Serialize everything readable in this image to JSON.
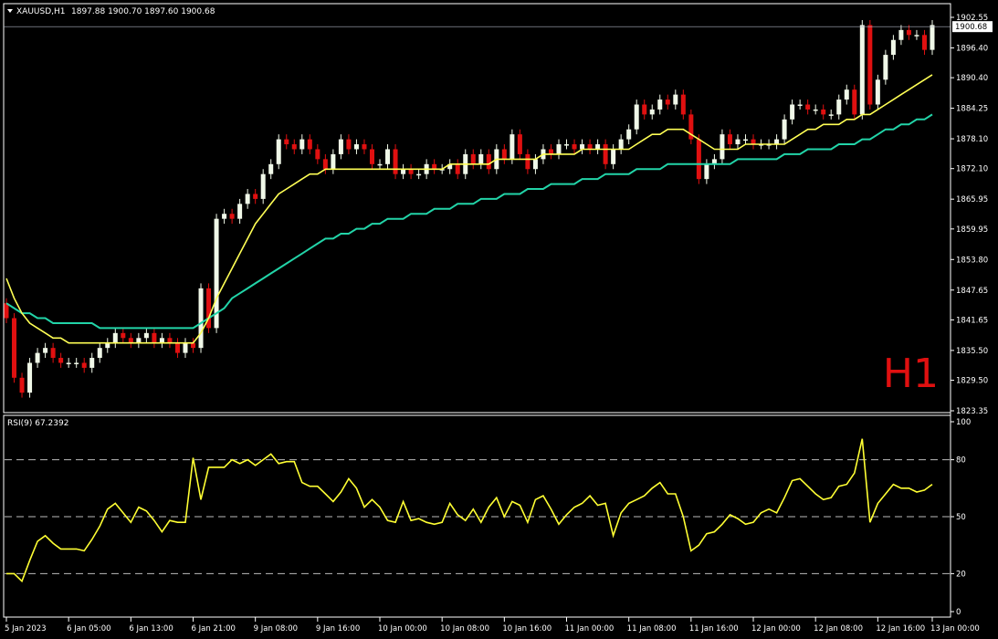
{
  "header": {
    "title": "XAUUSD,H1",
    "ohlc": "1897.88 1900.70 1897.60 1900.68"
  },
  "timeframe_badge": "H1",
  "colors": {
    "background": "#000000",
    "bull": "#f0f8e8",
    "bear": "#e01010",
    "ma_fast": "#ffff55",
    "ma_slow": "#22d4a8",
    "rsi": "#ffff33",
    "axis": "#ffffff",
    "badge": "#e01010"
  },
  "price_axis": {
    "ticks": [
      "1902.55",
      "1896.40",
      "1890.40",
      "1884.25",
      "1878.10",
      "1872.10",
      "1865.95",
      "1859.95",
      "1853.80",
      "1847.65",
      "1841.65",
      "1835.50",
      "1829.50",
      "1823.35"
    ],
    "current_price": "1900.68"
  },
  "time_axis": {
    "labels": [
      "5 Jan 2023",
      "6 Jan 05:00",
      "6 Jan 13:00",
      "6 Jan 21:00",
      "9 Jan 08:00",
      "9 Jan 16:00",
      "10 Jan 00:00",
      "10 Jan 08:00",
      "10 Jan 16:00",
      "11 Jan 00:00",
      "11 Jan 08:00",
      "11 Jan 16:00",
      "12 Jan 00:00",
      "12 Jan 08:00",
      "12 Jan 16:00",
      "13 Jan 00:00"
    ]
  },
  "rsi_panel": {
    "title": "RSI(9) 67.2392",
    "ticks": [
      "100",
      "80",
      "50",
      "20",
      "0"
    ]
  },
  "chart_data": [
    {
      "type": "candlestick",
      "title": "XAUUSD,H1",
      "ylim": [
        1823.35,
        1902.55
      ],
      "close": [
        1842,
        1830,
        1827,
        1833,
        1835,
        1836,
        1834,
        1833,
        1833,
        1833,
        1832,
        1834,
        1836,
        1837,
        1839,
        1838,
        1837,
        1838,
        1839,
        1837,
        1838,
        1837,
        1835,
        1837,
        1836,
        1848,
        1840,
        1862,
        1863,
        1862,
        1865,
        1867,
        1866,
        1871,
        1873,
        1878,
        1877,
        1876,
        1878,
        1876,
        1874,
        1872,
        1875,
        1878,
        1876,
        1877,
        1876,
        1873,
        1873,
        1876,
        1871,
        1872,
        1871,
        1871,
        1873,
        1872,
        1872,
        1873,
        1871,
        1875,
        1873,
        1875,
        1872,
        1876,
        1874,
        1879,
        1875,
        1872,
        1874,
        1876,
        1875,
        1877,
        1877,
        1876,
        1877,
        1876,
        1877,
        1873,
        1876,
        1878,
        1880,
        1885,
        1883,
        1884,
        1886,
        1885,
        1887,
        1883,
        1878,
        1870,
        1873,
        1874,
        1879,
        1877,
        1878,
        1878,
        1877,
        1877,
        1877,
        1878,
        1882,
        1885,
        1885,
        1884,
        1884,
        1883,
        1883,
        1886,
        1888,
        1883,
        1901,
        1885,
        1890,
        1895,
        1898,
        1900,
        1899,
        1899,
        1896,
        1901
      ],
      "open": [
        1845,
        1842,
        1830,
        1827,
        1833,
        1835,
        1836,
        1834,
        1833,
        1833,
        1833,
        1832,
        1834,
        1836,
        1837,
        1839,
        1838,
        1837,
        1838,
        1839,
        1837,
        1838,
        1837,
        1835,
        1837,
        1836,
        1848,
        1840,
        1862,
        1863,
        1862,
        1865,
        1867,
        1866,
        1871,
        1873,
        1878,
        1877,
        1876,
        1878,
        1876,
        1874,
        1872,
        1875,
        1878,
        1876,
        1877,
        1876,
        1873,
        1873,
        1876,
        1871,
        1872,
        1871,
        1871,
        1873,
        1872,
        1872,
        1873,
        1871,
        1875,
        1873,
        1875,
        1872,
        1876,
        1874,
        1879,
        1875,
        1872,
        1874,
        1876,
        1875,
        1877,
        1877,
        1876,
        1877,
        1876,
        1877,
        1873,
        1876,
        1878,
        1880,
        1885,
        1883,
        1884,
        1886,
        1885,
        1887,
        1883,
        1878,
        1870,
        1873,
        1874,
        1879,
        1877,
        1878,
        1878,
        1877,
        1877,
        1877,
        1878,
        1882,
        1885,
        1885,
        1884,
        1884,
        1883,
        1883,
        1886,
        1888,
        1883,
        1901,
        1885,
        1890,
        1895,
        1898,
        1900,
        1899,
        1899,
        1896
      ],
      "ma_fast": [
        1850,
        1846,
        1843,
        1841,
        1840,
        1839,
        1838,
        1838,
        1837,
        1837,
        1837,
        1837,
        1837,
        1837,
        1837,
        1837,
        1837,
        1837,
        1837,
        1837,
        1837,
        1837,
        1837,
        1837,
        1837,
        1839,
        1842,
        1846,
        1849,
        1852,
        1855,
        1858,
        1861,
        1863,
        1865,
        1867,
        1868,
        1869,
        1870,
        1871,
        1871,
        1872,
        1872,
        1872,
        1872,
        1872,
        1872,
        1872,
        1872,
        1872,
        1872,
        1872,
        1872,
        1872,
        1872,
        1872,
        1872,
        1873,
        1873,
        1873,
        1873,
        1873,
        1873,
        1874,
        1874,
        1874,
        1874,
        1874,
        1874,
        1875,
        1875,
        1875,
        1875,
        1875,
        1876,
        1876,
        1876,
        1876,
        1876,
        1876,
        1876,
        1877,
        1878,
        1879,
        1879,
        1880,
        1880,
        1880,
        1879,
        1878,
        1877,
        1876,
        1876,
        1876,
        1876,
        1877,
        1877,
        1877,
        1877,
        1877,
        1877,
        1878,
        1879,
        1880,
        1880,
        1881,
        1881,
        1881,
        1882,
        1882,
        1883,
        1883,
        1884,
        1885,
        1886,
        1887,
        1888,
        1889,
        1890,
        1891
      ],
      "ma_slow": [
        1845,
        1844,
        1843,
        1843,
        1842,
        1842,
        1841,
        1841,
        1841,
        1841,
        1841,
        1841,
        1840,
        1840,
        1840,
        1840,
        1840,
        1840,
        1840,
        1840,
        1840,
        1840,
        1840,
        1840,
        1840,
        1841,
        1842,
        1843,
        1844,
        1846,
        1847,
        1848,
        1849,
        1850,
        1851,
        1852,
        1853,
        1854,
        1855,
        1856,
        1857,
        1858,
        1858,
        1859,
        1859,
        1860,
        1860,
        1861,
        1861,
        1862,
        1862,
        1862,
        1863,
        1863,
        1863,
        1864,
        1864,
        1864,
        1865,
        1865,
        1865,
        1866,
        1866,
        1866,
        1867,
        1867,
        1867,
        1868,
        1868,
        1868,
        1869,
        1869,
        1869,
        1869,
        1870,
        1870,
        1870,
        1871,
        1871,
        1871,
        1871,
        1872,
        1872,
        1872,
        1872,
        1873,
        1873,
        1873,
        1873,
        1873,
        1873,
        1873,
        1873,
        1873,
        1874,
        1874,
        1874,
        1874,
        1874,
        1874,
        1875,
        1875,
        1875,
        1876,
        1876,
        1876,
        1876,
        1877,
        1877,
        1877,
        1878,
        1878,
        1879,
        1880,
        1880,
        1881,
        1881,
        1882,
        1882,
        1883
      ]
    },
    {
      "type": "line",
      "title": "RSI(9) 67.2392",
      "ylim": [
        0,
        100
      ],
      "levels": [
        20,
        50,
        80
      ],
      "values": [
        20,
        20,
        16,
        27,
        37,
        40,
        36,
        33,
        33,
        33,
        32,
        38,
        45,
        54,
        57,
        52,
        47,
        55,
        53,
        48,
        42,
        48,
        47,
        47,
        81,
        59,
        76,
        76,
        76,
        80,
        78,
        80,
        77,
        80,
        83,
        78,
        79,
        79,
        68,
        66,
        66,
        62,
        58,
        63,
        70,
        65,
        55,
        59,
        55,
        48,
        47,
        58,
        48,
        49,
        47,
        46,
        47,
        57,
        51,
        48,
        54,
        47,
        55,
        60,
        50,
        58,
        56,
        47,
        59,
        61,
        54,
        46,
        51,
        55,
        57,
        61,
        56,
        57,
        40,
        52,
        57,
        59,
        61,
        65,
        68,
        62,
        62,
        50,
        32,
        35,
        41,
        42,
        46,
        51,
        49,
        46,
        47,
        52,
        54,
        52,
        60,
        69,
        70,
        66,
        62,
        59,
        60,
        66,
        67,
        73,
        91,
        47,
        57,
        62,
        67,
        65,
        65,
        63,
        64,
        67
      ]
    }
  ]
}
